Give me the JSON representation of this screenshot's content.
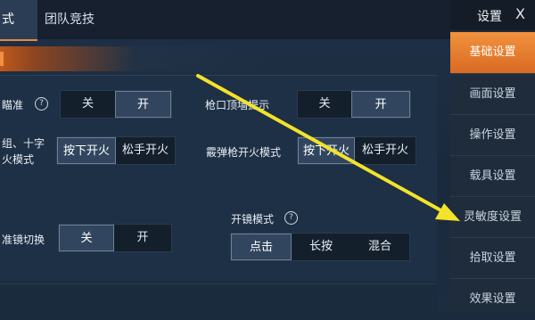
{
  "tabs": {
    "active_label": "式",
    "team_label": "团队竞技"
  },
  "section": {
    "title": ""
  },
  "settings": {
    "row1_left_label": "瞄准",
    "row1_left_help": "?",
    "row1_left_options": [
      "关",
      "开"
    ],
    "row1_right_label": "枪口顶墙提示",
    "row1_right_options": [
      "关",
      "开"
    ],
    "row2_left_label_a": "组、十字",
    "row2_left_label_b": "火模式",
    "row2_left_options": [
      "按下开火",
      "松手开火"
    ],
    "row2_right_label": "霰弹枪开火模式",
    "row2_right_options": [
      "按下开火",
      "松手开火"
    ],
    "row3_left_label": "准镜切换",
    "row3_left_options": [
      "关",
      "开"
    ],
    "row3_right_label": "开镜模式",
    "row3_right_help": "?",
    "row3_right_options": [
      "点击",
      "长按",
      "混合"
    ]
  },
  "sidebar": {
    "title": "设置",
    "close": "X",
    "items": [
      {
        "label": "基础设置"
      },
      {
        "label": "画面设置"
      },
      {
        "label": "操作设置"
      },
      {
        "label": "载具设置"
      },
      {
        "label": "灵敏度设置"
      },
      {
        "label": "拾取设置"
      },
      {
        "label": "效果设置"
      }
    ]
  },
  "colors": {
    "accent": "#e8832f",
    "arrow": "#f3e32a",
    "background": "#1b2a3d"
  }
}
